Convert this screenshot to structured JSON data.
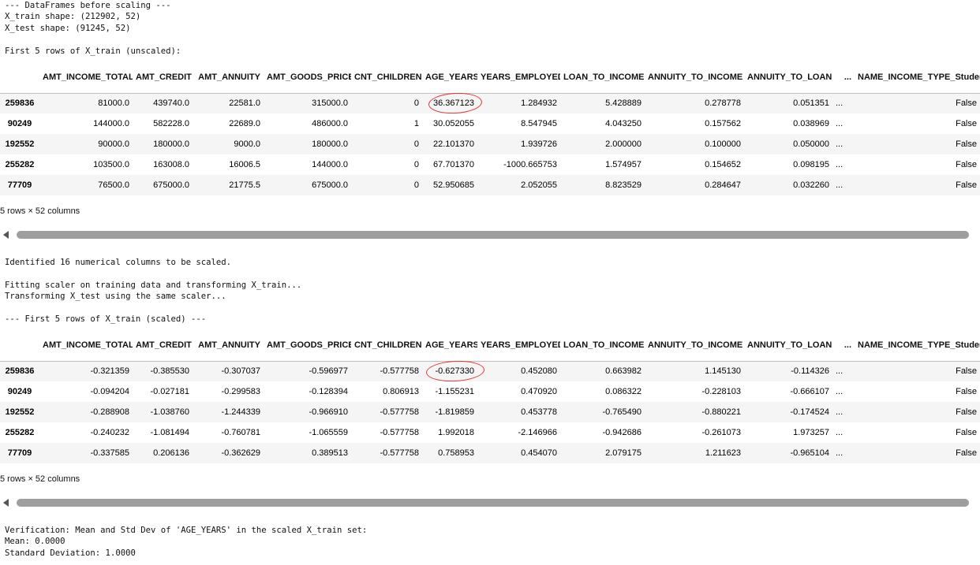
{
  "block1": {
    "lines": [
      "--- DataFrames before scaling ---",
      "X_train shape: (212902, 52)",
      "X_test shape: (91245, 52)",
      "",
      "First 5 rows of X_train (unscaled):"
    ]
  },
  "table1": {
    "columns": [
      "",
      "AMT_INCOME_TOTAL",
      "AMT_CREDIT",
      "AMT_ANNUITY",
      "AMT_GOODS_PRICE",
      "CNT_CHILDREN",
      "AGE_YEARS",
      "YEARS_EMPLOYED",
      "LOAN_TO_INCOME",
      "ANNUITY_TO_INCOME",
      "ANNUITY_TO_LOAN",
      "...",
      "NAME_INCOME_TYPE_Student"
    ],
    "rows": [
      [
        "259836",
        "81000.0",
        "439740.0",
        "22581.0",
        "315000.0",
        "0",
        "36.367123",
        "1.284932",
        "5.428889",
        "0.278778",
        "0.051351",
        "...",
        "False"
      ],
      [
        "90249",
        "144000.0",
        "582228.0",
        "22689.0",
        "486000.0",
        "1",
        "30.052055",
        "8.547945",
        "4.043250",
        "0.157562",
        "0.038969",
        "...",
        "False"
      ],
      [
        "192552",
        "90000.0",
        "180000.0",
        "9000.0",
        "180000.0",
        "0",
        "22.101370",
        "1.939726",
        "2.000000",
        "0.100000",
        "0.050000",
        "...",
        "False"
      ],
      [
        "255282",
        "103500.0",
        "163008.0",
        "16006.5",
        "144000.0",
        "0",
        "67.701370",
        "-1000.665753",
        "1.574957",
        "0.154652",
        "0.098195",
        "...",
        "False"
      ],
      [
        "77709",
        "76500.0",
        "675000.0",
        "21775.5",
        "675000.0",
        "0",
        "52.950685",
        "2.052055",
        "8.823529",
        "0.284647",
        "0.032260",
        "...",
        "False"
      ]
    ],
    "summary": "5 rows × 52 columns"
  },
  "block2": {
    "lines": [
      "Identified 16 numerical columns to be scaled.",
      "",
      "Fitting scaler on training data and transforming X_train...",
      "Transforming X_test using the same scaler...",
      "",
      "--- First 5 rows of X_train (scaled) ---"
    ]
  },
  "table2": {
    "columns": [
      "",
      "AMT_INCOME_TOTAL",
      "AMT_CREDIT",
      "AMT_ANNUITY",
      "AMT_GOODS_PRICE",
      "CNT_CHILDREN",
      "AGE_YEARS",
      "YEARS_EMPLOYED",
      "LOAN_TO_INCOME",
      "ANNUITY_TO_INCOME",
      "ANNUITY_TO_LOAN",
      "...",
      "NAME_INCOME_TYPE_Student"
    ],
    "rows": [
      [
        "259836",
        "-0.321359",
        "-0.385530",
        "-0.307037",
        "-0.596977",
        "-0.577758",
        "-0.627330",
        "0.452080",
        "0.663982",
        "1.145130",
        "-0.114326",
        "...",
        "False"
      ],
      [
        "90249",
        "-0.094204",
        "-0.027181",
        "-0.299583",
        "-0.128394",
        "0.806913",
        "-1.155231",
        "0.470920",
        "0.086322",
        "-0.228103",
        "-0.666107",
        "...",
        "False"
      ],
      [
        "192552",
        "-0.288908",
        "-1.038760",
        "-1.244339",
        "-0.966910",
        "-0.577758",
        "-1.819859",
        "0.453778",
        "-0.765490",
        "-0.880221",
        "-0.174524",
        "...",
        "False"
      ],
      [
        "255282",
        "-0.240232",
        "-1.081494",
        "-0.760781",
        "-1.065559",
        "-0.577758",
        "1.992018",
        "-2.146966",
        "-0.942686",
        "-0.261073",
        "1.973257",
        "...",
        "False"
      ],
      [
        "77709",
        "-0.337585",
        "0.206136",
        "-0.362629",
        "0.389513",
        "-0.577758",
        "0.758953",
        "0.454070",
        "2.079175",
        "1.211623",
        "-0.965104",
        "...",
        "False"
      ]
    ],
    "summary": "5 rows × 52 columns"
  },
  "block3": {
    "lines": [
      "Verification: Mean and Std Dev of 'AGE_YEARS' in the scaled X_train set:",
      "Mean: 0.0000",
      "Standard Deviation: 1.0000"
    ]
  },
  "colors": {
    "annotation": "#e23434",
    "scrollbar_thumb": "#9e9e9e",
    "stripe": "#f5f5f5"
  }
}
